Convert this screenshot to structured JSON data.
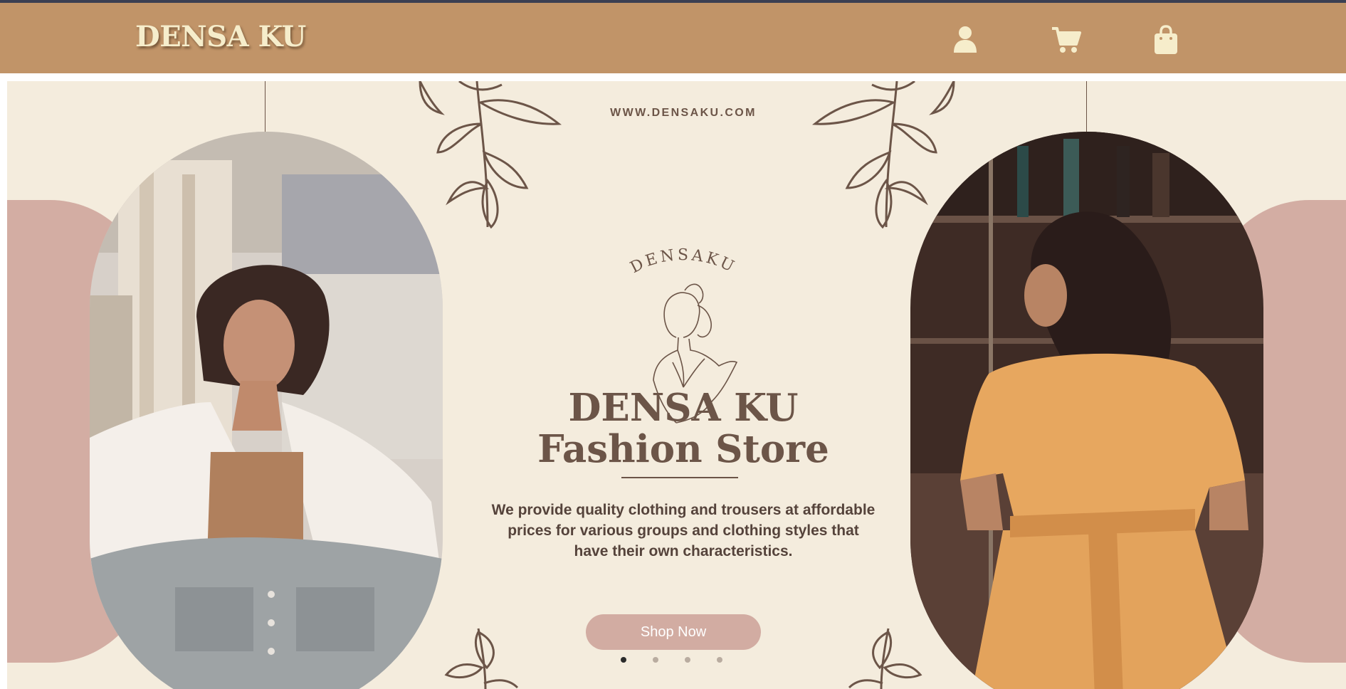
{
  "navbar": {
    "brand": "DENSA KU",
    "icons": [
      "user-icon",
      "cart-icon",
      "shopping-bag-icon"
    ]
  },
  "hero": {
    "website": "WWW.DENSAKU.COM",
    "emblem_text": "DENSAKU",
    "title_line1": "DENSA KU",
    "title_line2": "Fashion Store",
    "description": "We provide quality clothing and trousers at affordable prices for various groups and clothing styles that have their own characteristics.",
    "cta_label": "Shop Now",
    "slide_count": 4,
    "active_slide": 1
  },
  "colors": {
    "navbar": "#c19468",
    "brand_text": "#f6edcb",
    "hero_bg": "#f4ecdd",
    "accent_pink": "#d3ada3",
    "text_brown": "#6c5548"
  }
}
